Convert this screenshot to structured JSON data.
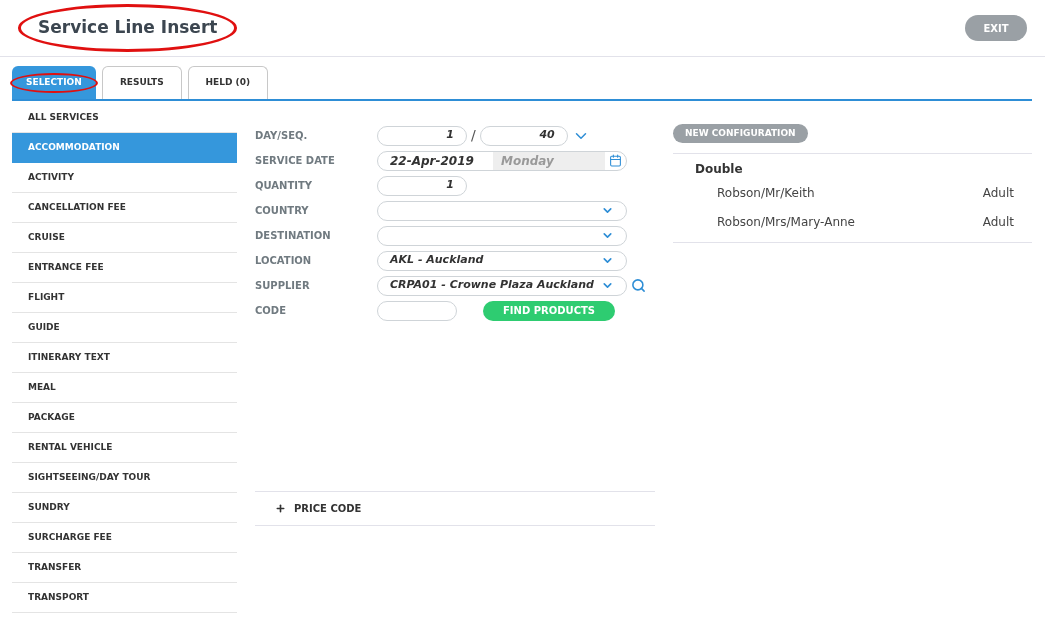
{
  "header": {
    "title": "Service Line Insert",
    "title_highlighted": true,
    "exit_label": "EXIT"
  },
  "tabs": [
    {
      "label": "SELECTION",
      "selected": true,
      "highlighted": true
    },
    {
      "label": "RESULTS",
      "selected": false,
      "highlighted": false
    },
    {
      "label": "HELD (0)",
      "selected": false,
      "highlighted": false
    }
  ],
  "sidebar": {
    "items": [
      {
        "label": "ALL SERVICES",
        "selected": false
      },
      {
        "label": "ACCOMMODATION",
        "selected": true
      },
      {
        "label": "ACTIVITY",
        "selected": false
      },
      {
        "label": "CANCELLATION FEE",
        "selected": false
      },
      {
        "label": "CRUISE",
        "selected": false
      },
      {
        "label": "ENTRANCE FEE",
        "selected": false
      },
      {
        "label": "FLIGHT",
        "selected": false
      },
      {
        "label": "GUIDE",
        "selected": false
      },
      {
        "label": "ITINERARY TEXT",
        "selected": false
      },
      {
        "label": "MEAL",
        "selected": false
      },
      {
        "label": "PACKAGE",
        "selected": false
      },
      {
        "label": "RENTAL VEHICLE",
        "selected": false
      },
      {
        "label": "SIGHTSEEING/DAY TOUR",
        "selected": false
      },
      {
        "label": "SUNDRY",
        "selected": false
      },
      {
        "label": "SURCHARGE FEE",
        "selected": false
      },
      {
        "label": "TRANSFER",
        "selected": false
      },
      {
        "label": "TRANSPORT",
        "selected": false
      }
    ]
  },
  "form": {
    "fields": [
      {
        "kind": "pair",
        "label": "DAY/SEQ.",
        "value": "1",
        "separator": "/",
        "value_2": "40"
      },
      {
        "kind": "date",
        "label": "SERVICE DATE",
        "value": "22-Apr-2019",
        "day": "Monday"
      },
      {
        "kind": "number",
        "label": "QUANTITY",
        "value": "1"
      },
      {
        "kind": "select",
        "label": "COUNTRY"
      },
      {
        "kind": "select",
        "label": "DESTINATION"
      },
      {
        "kind": "select",
        "label": "LOCATION",
        "value": "AKL - Auckland"
      },
      {
        "kind": "select_search",
        "label": "SUPPLIER",
        "value": "CRPA01 - Crowne Plaza Auckland"
      },
      {
        "kind": "code",
        "label": "CODE",
        "button": "FIND PRODUCTS"
      }
    ],
    "price_code": "PRICE CODE"
  },
  "configuration": {
    "button": "NEW CONFIGURATION",
    "room": "Double",
    "passengers": [
      {
        "name": "Robson/Mr/Keith",
        "type": "Adult"
      },
      {
        "name": "Robson/Mrs/Mary-Anne",
        "type": "Adult"
      }
    ]
  }
}
